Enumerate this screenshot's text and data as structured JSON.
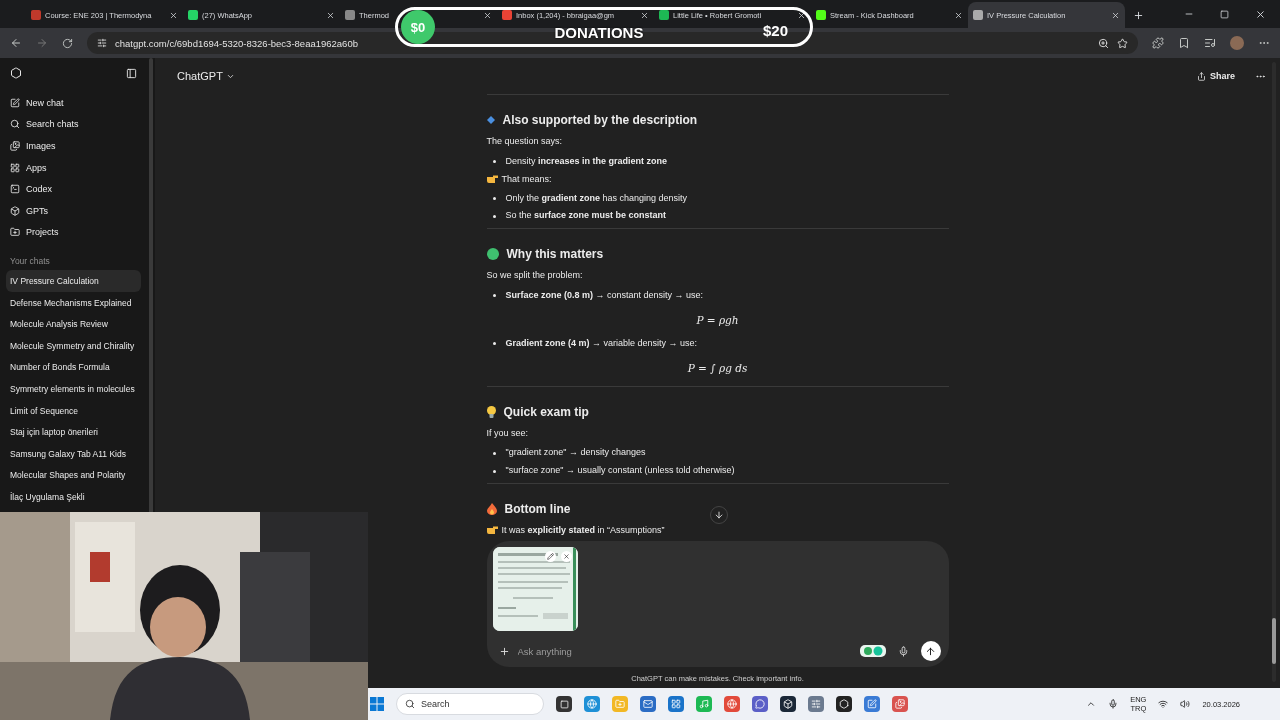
{
  "browser": {
    "tabs": [
      {
        "title": "Course: ENE 203 | Thermodyna",
        "selected": false
      },
      {
        "title": "(27) WhatsApp",
        "selected": false
      },
      {
        "title": "Thermod",
        "selected": false
      },
      {
        "title": "Inbox (1,204) - bbraigaa@gm",
        "selected": false
      },
      {
        "title": "Little Life • Robert Gromoti",
        "selected": false
      },
      {
        "title": "Stream - Kick Dashboard",
        "selected": false
      },
      {
        "title": "IV Pressure Calculation",
        "selected": true
      }
    ],
    "url": "chatgpt.com/c/69bd1694-5320-8326-bec3-8eaa1962a60b"
  },
  "donations": {
    "current": "$0",
    "label": "DONATIONS",
    "goal": "$20"
  },
  "sidebar": {
    "nav": [
      "New chat",
      "Search chats",
      "Images",
      "Apps",
      "Codex",
      "GPTs",
      "Projects"
    ],
    "section_label": "Your chats",
    "chats": [
      {
        "title": "IV Pressure Calculation",
        "selected": true
      },
      {
        "title": "Defense Mechanisms Explained",
        "selected": false
      },
      {
        "title": "Molecule Analysis Review",
        "selected": false
      },
      {
        "title": "Molecule Symmetry and Chirality",
        "selected": false
      },
      {
        "title": "Number of Bonds Formula",
        "selected": false
      },
      {
        "title": "Symmetry elements in molecules",
        "selected": false
      },
      {
        "title": "Limit of Sequence",
        "selected": false
      },
      {
        "title": "Staj için laptop önerileri",
        "selected": false
      },
      {
        "title": "Samsung Galaxy Tab A11 Kids",
        "selected": false
      },
      {
        "title": "Molecular Shapes and Polarity",
        "selected": false
      },
      {
        "title": "İlaç Uygulama Şekli",
        "selected": false
      }
    ]
  },
  "header": {
    "model": "ChatGPT",
    "share": "Share"
  },
  "message": [
    {
      "kind": "divider"
    },
    {
      "kind": "heading",
      "text": "Also supported by the description"
    },
    {
      "kind": "para",
      "text": "The question says:"
    },
    {
      "kind": "bullet",
      "text": "Density **increases in the gradient zone**"
    },
    {
      "kind": "pointer",
      "text": "That means:"
    },
    {
      "kind": "bullet",
      "text": "Only the **gradient zone** has changing density"
    },
    {
      "kind": "bullet",
      "text": "So the **surface zone must be constant**"
    },
    {
      "kind": "divider"
    },
    {
      "kind": "heading",
      "text": "Why this matters"
    },
    {
      "kind": "para",
      "text": "So we split the problem:"
    },
    {
      "kind": "bullet",
      "text": "**Surface zone (0.8 m)** → constant density → use:"
    },
    {
      "kind": "formula",
      "text": "P = ρgh"
    },
    {
      "kind": "bullet",
      "text": "**Gradient zone (4 m)** → variable density → use:"
    },
    {
      "kind": "formula",
      "text": "P = ∫ ρg ds"
    },
    {
      "kind": "divider"
    },
    {
      "kind": "heading",
      "text": "Quick exam tip"
    },
    {
      "kind": "para",
      "text": "If you see:"
    },
    {
      "kind": "bullet",
      "text": "\"gradient zone\" → density changes"
    },
    {
      "kind": "bullet",
      "text": "\"surface zone\" → usually constant (unless told otherwise)"
    },
    {
      "kind": "divider"
    },
    {
      "kind": "heading",
      "text": "Bottom line"
    },
    {
      "kind": "pointer",
      "text": "It was **explicitly stated** in “Assumptions”"
    }
  ],
  "composer": {
    "placeholder": "Ask anything"
  },
  "disclaimer": "ChatGPT can make mistakes. Check important info.",
  "taskbar": {
    "search_placeholder": "Search",
    "language": "ENG",
    "layout": "TRQ",
    "date": "20.03.2026"
  }
}
